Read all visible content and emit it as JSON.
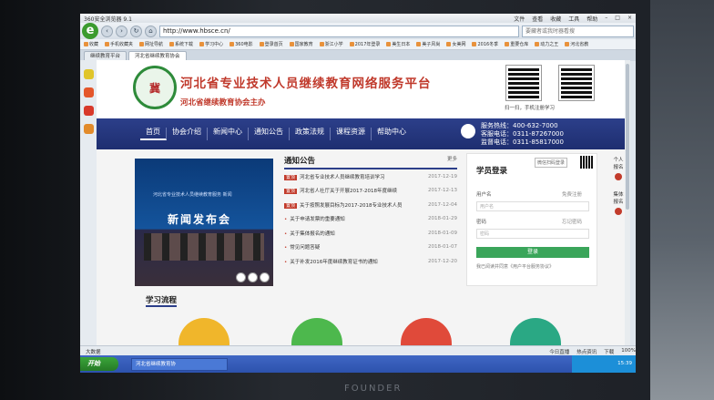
{
  "browser": {
    "app_title": "360安全浏览器 9.1",
    "menu": [
      "文件",
      "查看",
      "收藏",
      "工具",
      "帮助"
    ],
    "address": "http://www.hbsce.cn/",
    "search_placeholder": "要藏者或我时器看搜",
    "bookmarks": [
      "收藏",
      "手机收藏夹",
      "网址导航",
      "系统下载",
      "学习中心",
      "360电影",
      "登录首页",
      "国家教育",
      "浙江小学",
      "2017年登录",
      "美生日本",
      "美子风尚",
      "女美网",
      "2016冬季",
      "重要仓库",
      "动力之王",
      "河北省教"
    ],
    "tabs": [
      "继续教育平台",
      "河北省继续教育协会"
    ]
  },
  "site": {
    "title": "河北省专业技术人员继续教育网络服务平台",
    "subtitle": "河北省继续教育协会主办",
    "qr_caption": "扫一扫，手机注册学习",
    "nav": [
      "首页",
      "协会介绍",
      "新闻中心",
      "通知公告",
      "政策法规",
      "课程资源",
      "帮助中心"
    ],
    "hotline": [
      "服务热线：400-632-7000",
      "客服电话：0311-87267000",
      "监督电话：0311-85817000"
    ]
  },
  "news_image": {
    "caption": "河北省专业技术人员继续教育服务 新闻",
    "headline": "新闻发布会"
  },
  "notice": {
    "title": "通知公告",
    "more": "更多",
    "items": [
      {
        "tag": "置顶",
        "text": "河北省专业技术人员继续教育培训学习",
        "date": "2017-12-19"
      },
      {
        "tag": "置顶",
        "text": "河北省人社厅关于开展2017-2018年度继续",
        "date": "2017-12-13"
      },
      {
        "tag": "置顶",
        "text": "关于按照发展目标为2017-2018专业技术人员",
        "date": "2017-12-04"
      },
      {
        "tag": "",
        "text": "关于申请发票的重要通知",
        "date": "2018-01-29"
      },
      {
        "tag": "",
        "text": "关于集体报名的通知",
        "date": "2018-01-09"
      },
      {
        "tag": "",
        "text": "常见问题答疑",
        "date": "2018-01-07"
      },
      {
        "tag": "",
        "text": "关于补发2016年度继续教育证书的通知",
        "date": "2017-12-20"
      }
    ]
  },
  "login": {
    "title": "学员登录",
    "wechat_link": "微信扫码登录",
    "username_label": "用户名",
    "username_hint": "免费注册",
    "username_placeholder": "用户名",
    "password_label": "密码",
    "password_hint": "忘记密码",
    "password_placeholder": "密码",
    "button": "登录",
    "note": "我已阅读并同意《用户平台服务协议》"
  },
  "process": {
    "title": "学习流程"
  },
  "side_float": [
    "个人",
    "报名",
    "集体",
    "报名"
  ],
  "status": {
    "left": [
      "大数据"
    ],
    "right": [
      "今日直播",
      "热点资讯",
      "下载",
      "100%"
    ]
  },
  "taskbar": {
    "start": "开始",
    "item": "河北省继续教育协",
    "clock": "15:39"
  },
  "monitor": {
    "brand": "FOUNDER"
  },
  "colors": {
    "nav_blue": "#2c3f8a",
    "title_red": "#c0392b",
    "login_green": "#3aa55a"
  }
}
